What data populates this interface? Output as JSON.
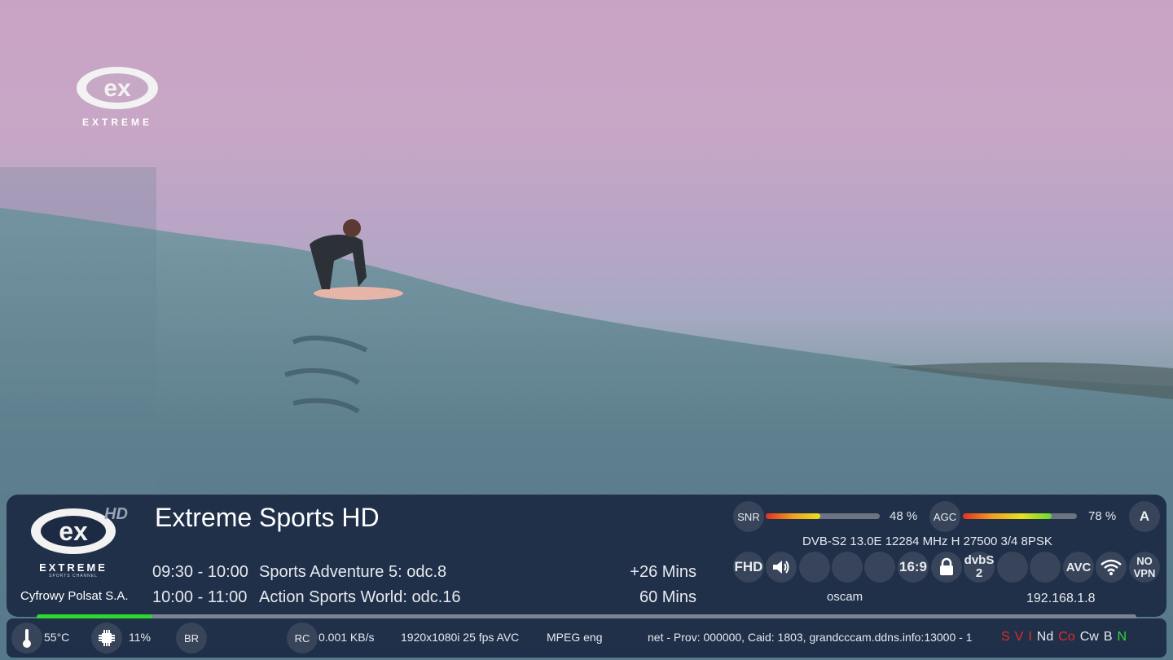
{
  "video": {
    "channel_logo_text": "ex",
    "channel_logo_wordmark": "EXTREME"
  },
  "infobar": {
    "logo_text": "ex",
    "logo_wordmark": "EXTREME",
    "logo_subtext": "SPORTS CHANNEL",
    "hd_tag": "HD",
    "provider": "Cyfrowy Polsat S.A.",
    "channel_name": "Extreme Sports HD",
    "epg": [
      {
        "time": "09:30 - 10:00",
        "title": "Sports Adventure 5: odc.8",
        "duration": "+26 Mins"
      },
      {
        "time": "10:00 - 11:00",
        "title": "Action Sports World: odc.16",
        "duration": "60 Mins"
      }
    ],
    "progress_fraction": 0.105
  },
  "signal": {
    "snr_label": "SNR",
    "snr_value": "48 %",
    "snr_fraction": 0.48,
    "agc_label": "AGC",
    "agc_value": "78 %",
    "agc_fraction": 0.78,
    "audio_badge": "A",
    "tuning": "DVB-S2 13.0E 12284 MHz H 27500 3/4 8PSK"
  },
  "badges": {
    "fhd": "FHD",
    "aspect": "16:9",
    "dvb_line1": "dvbS",
    "dvb_line2": "2",
    "codec": "AVC",
    "vpn_line1": "NO",
    "vpn_line2": "VPN",
    "cam": "oscam",
    "ip": "192.168.1.8"
  },
  "bottom": {
    "temp": "55°C",
    "cpu": "11%",
    "br": "BR",
    "rc": "RC",
    "bitrate": "0.001 KB/s",
    "video_info": "1920x1080i  25 fps  AVC",
    "audio_info": "MPEG eng",
    "ecm_info": "net - Prov: 000000, Caid: 1803, grandcccam.ddns.info:13000 - 1",
    "flags": [
      {
        "text": "S",
        "color": "#e02a2a"
      },
      {
        "text": "V",
        "color": "#e02a2a"
      },
      {
        "text": "I",
        "color": "#e02a2a"
      },
      {
        "text": "Nd",
        "color": "#e6e9ef"
      },
      {
        "text": "Co",
        "color": "#e02a2a"
      },
      {
        "text": "Cw",
        "color": "#e6e9ef"
      },
      {
        "text": "B",
        "color": "#e6e9ef"
      },
      {
        "text": "N",
        "color": "#2fd62f"
      }
    ]
  }
}
